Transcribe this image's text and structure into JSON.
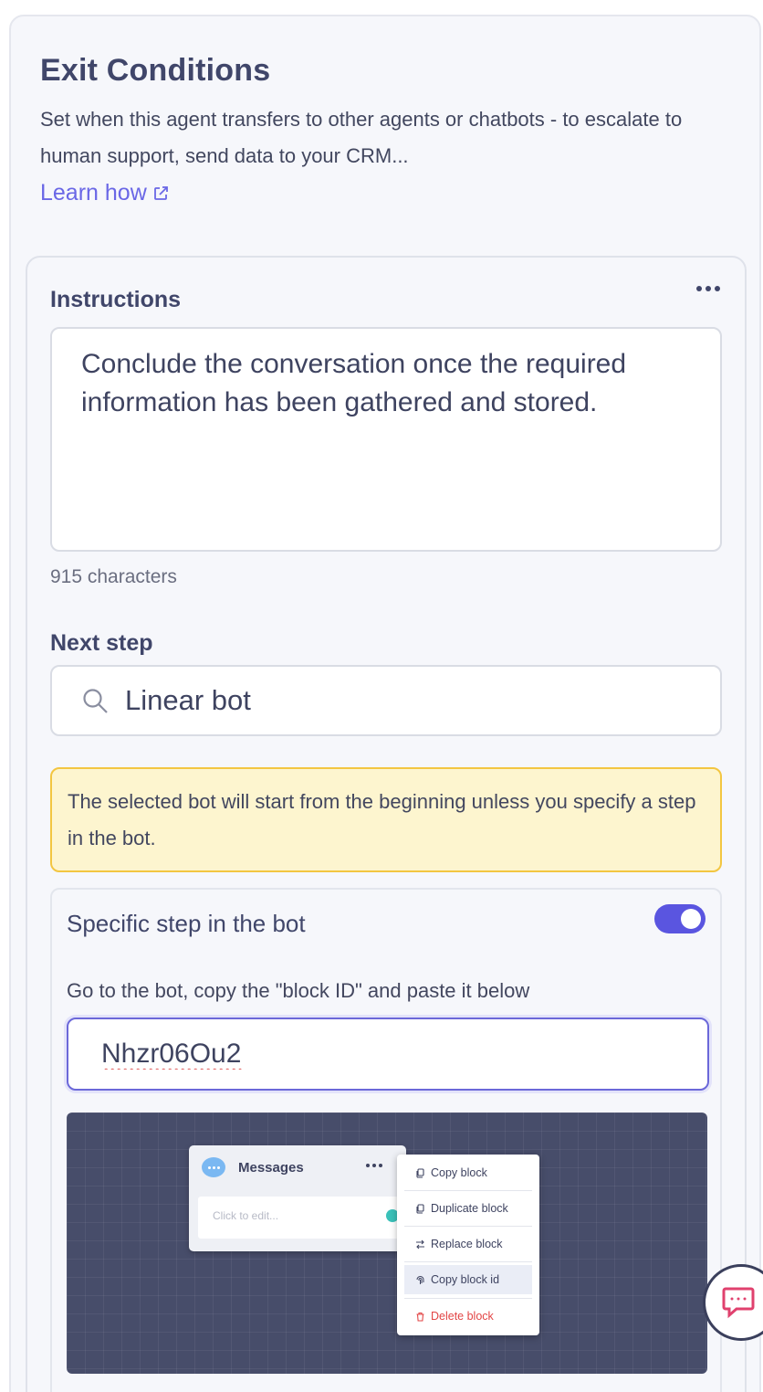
{
  "header": {
    "title": "Exit Conditions",
    "description": "Set when this agent transfers to other agents or chatbots - to escalate to human support, send data to your CRM...",
    "learn_link": "Learn how"
  },
  "instructions": {
    "label": "Instructions",
    "value": "Conclude the conversation once the required information has been gathered and stored.",
    "char_count": "915 characters"
  },
  "next_step": {
    "label": "Next step",
    "search_value": "Linear bot"
  },
  "notice": {
    "text": "The selected bot will start from the beginning unless you specify a step in the bot."
  },
  "specific_step": {
    "title": "Specific step in the bot",
    "toggle_on": true,
    "help": "Go to the bot, copy the \"block ID\" and paste it below",
    "block_id": "Nhzr06Ou2"
  },
  "preview": {
    "card_title": "Messages",
    "card_placeholder": "Click to edit...",
    "menu_items": [
      {
        "label": "Copy block",
        "icon": "copy-icon"
      },
      {
        "label": "Duplicate block",
        "icon": "duplicate-icon"
      },
      {
        "label": "Replace block",
        "icon": "swap-icon"
      },
      {
        "label": "Copy block id",
        "icon": "fingerprint-icon"
      },
      {
        "label": "Delete block",
        "icon": "trash-icon"
      }
    ]
  },
  "colors": {
    "accent": "#5a55e0",
    "link": "#6a67e6",
    "warning_bg": "#fdf5cf",
    "warning_border": "#f3c641",
    "danger": "#e24545",
    "chat_icon": "#e0416e"
  }
}
